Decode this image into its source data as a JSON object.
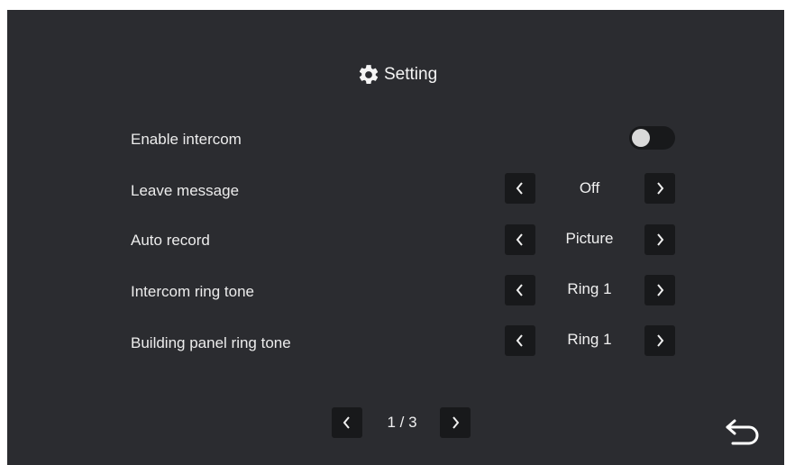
{
  "header": {
    "title": "Setting",
    "icon": "gear-icon"
  },
  "settings": [
    {
      "label": "Enable intercom",
      "type": "toggle",
      "enabled": false
    },
    {
      "label": "Leave message",
      "type": "selector",
      "value": "Off"
    },
    {
      "label": "Auto record",
      "type": "selector",
      "value": "Picture"
    },
    {
      "label": "Intercom ring tone",
      "type": "selector",
      "value": "Ring 1"
    },
    {
      "label": "Building panel ring tone",
      "type": "selector",
      "value": "Ring 1"
    }
  ],
  "pagination": {
    "text": "1 / 3",
    "current": 1,
    "total": 3
  },
  "footer": {
    "back_icon": "back-arrow-icon"
  },
  "colors": {
    "background": "#2b2c30",
    "button": "#18191b",
    "text": "#f2f2f2"
  }
}
